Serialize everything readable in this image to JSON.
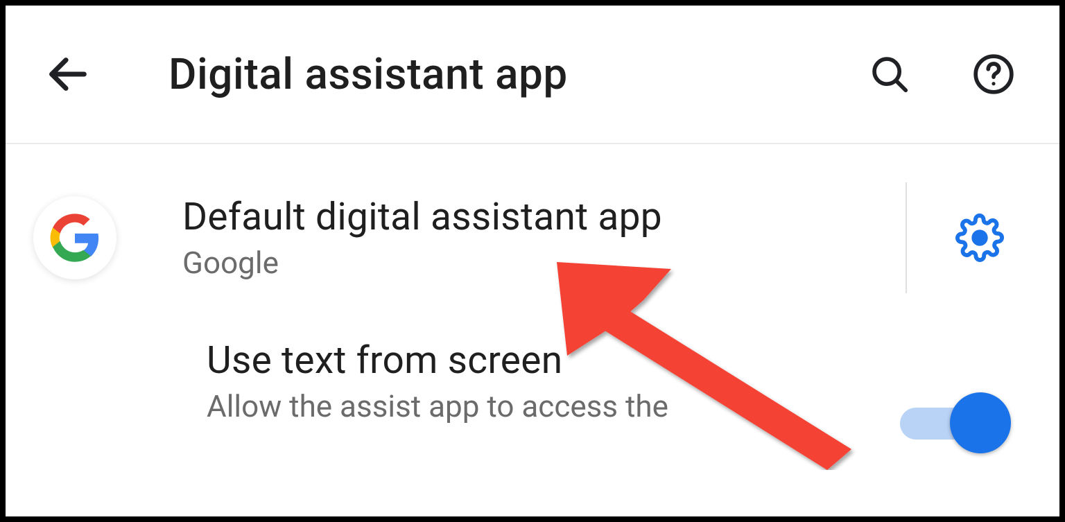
{
  "header": {
    "title": "Digital assistant app"
  },
  "rows": {
    "default_app": {
      "title": "Default digital assistant app",
      "subtitle": "Google"
    },
    "use_text": {
      "title": "Use text from screen",
      "subtitle": "Allow the assist app to access the",
      "toggle_on": true
    }
  },
  "colors": {
    "accent": "#1a73e8",
    "arrow": "#f44336"
  }
}
